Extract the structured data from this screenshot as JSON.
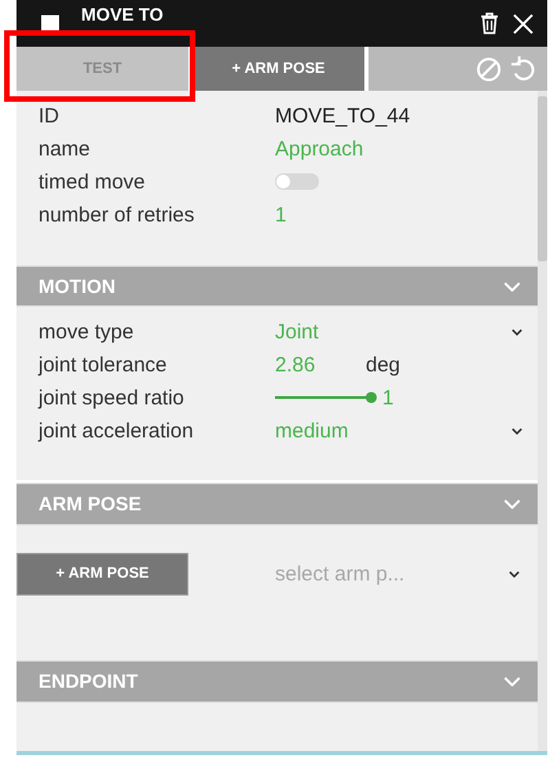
{
  "window": {
    "title": "MOVE TO"
  },
  "toolbar": {
    "buttons": [
      {
        "label": "TEST",
        "disabled": true
      },
      {
        "label": "+ ARM POSE",
        "disabled": false
      }
    ]
  },
  "properties": [
    {
      "kind": "text",
      "label": "ID",
      "value": "MOVE_TO_44",
      "editable": false
    },
    {
      "kind": "text",
      "label": "name",
      "value": "Approach",
      "editable": true
    },
    {
      "kind": "toggle",
      "label": "timed move",
      "on": false
    },
    {
      "kind": "text",
      "label": "number of retries",
      "value": "1",
      "editable": true
    }
  ],
  "sections": [
    {
      "title": "MOTION",
      "rows": [
        {
          "kind": "select",
          "label": "move type",
          "value": "Joint"
        },
        {
          "kind": "number",
          "label": "joint tolerance",
          "value": "2.86",
          "unit": "deg"
        },
        {
          "kind": "slider",
          "label": "joint speed ratio",
          "level": 1,
          "reading": "1"
        },
        {
          "kind": "select",
          "label": "joint acceleration",
          "value": "medium"
        }
      ]
    },
    {
      "title": "ARM POSE",
      "add_button": "+ ARM POSE",
      "select_placeholder": "select arm p..."
    },
    {
      "title": "ENDPOINT"
    }
  ],
  "annotations": [
    {
      "kind": "frame"
    }
  ]
}
